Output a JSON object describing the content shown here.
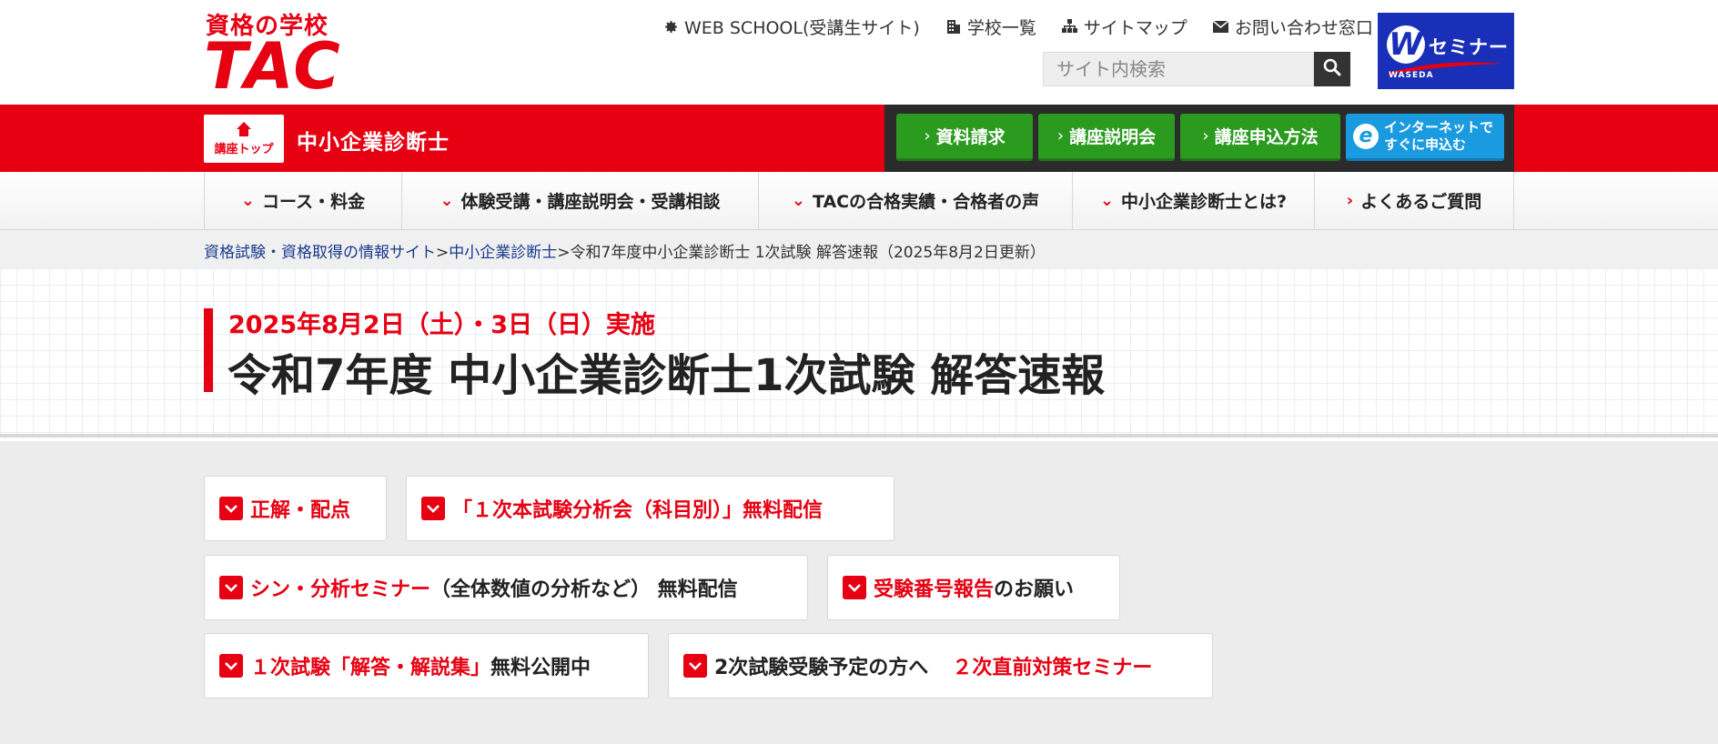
{
  "header": {
    "logo": {
      "tagline": "資格の学校",
      "wordmark": "TAC"
    },
    "util_links": [
      {
        "label": "WEB SCHOOL(受講生サイト)",
        "icon": "gear-icon"
      },
      {
        "label": "学校一覧",
        "icon": "building-icon"
      },
      {
        "label": "サイトマップ",
        "icon": "sitemap-icon"
      },
      {
        "label": "お問い合わせ窓口",
        "icon": "mail-icon"
      }
    ],
    "search": {
      "placeholder": "サイト内検索",
      "value": ""
    },
    "banner": {
      "letter": "W",
      "label": "セミナー",
      "sub": "WASEDA"
    }
  },
  "course_bar": {
    "top_label": "講座トップ",
    "course_name": "中小企業診断士",
    "cta": [
      {
        "label": "資料請求"
      },
      {
        "label": "講座説明会"
      },
      {
        "label": "講座申込方法"
      }
    ],
    "internet": {
      "line1": "インターネットで",
      "line2": "すぐに申込む"
    }
  },
  "nav": [
    {
      "label": "コース・料金"
    },
    {
      "label": "体験受講・講座説明会・受講相談"
    },
    {
      "label": "TACの合格実績・合格者の声"
    },
    {
      "label": "中小企業診断士とは?"
    },
    {
      "label": "よくあるご質問"
    }
  ],
  "breadcrumb": {
    "link1": "資格試験・資格取得の情報サイト",
    "sep": ">",
    "link2": "中小企業診断士",
    "current": "令和7年度中小企業診断士 1次試験 解答速報（2025年8月2日更新）"
  },
  "hero": {
    "date": "2025年8月2日（土）・3日（日）実施",
    "title": "令和7年度 中小企業診断士1次試験 解答速報"
  },
  "cards": [
    {
      "red": "正解・配点",
      "dark": ""
    },
    {
      "red": "「１次本試験分析会（科目別）」無料配信",
      "dark": ""
    },
    {
      "red": "シン・分析セミナー",
      "dark": "（全体数値の分析など） 無料配信"
    },
    {
      "red": "受験番号報告",
      "dark": "のお願い"
    },
    {
      "red": "１次試験「解答・解説集」",
      "dark": "無料公開中"
    },
    {
      "dark": "2次試験受験予定の方へ",
      "red": "２次直前対策セミナー"
    }
  ],
  "colors": {
    "brand_red": "#e60012",
    "cta_green": "#2b9b1f",
    "cta_blue": "#1a9be0",
    "waseda_blue": "#1a2fb8"
  }
}
